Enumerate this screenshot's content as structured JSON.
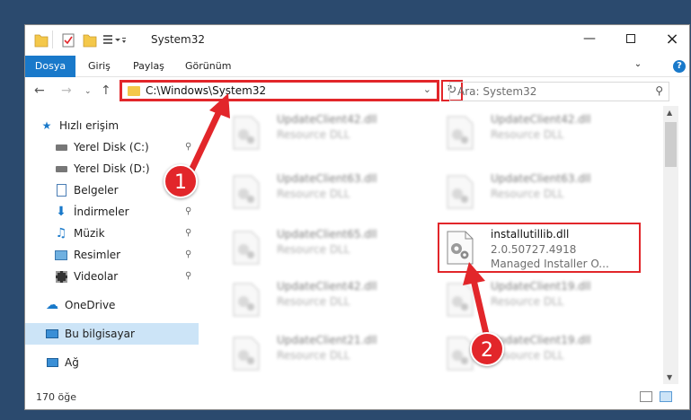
{
  "window": {
    "title": "System32"
  },
  "ribbon": {
    "tabs": [
      "Dosya",
      "Giriş",
      "Paylaş",
      "Görünüm"
    ],
    "help_label": "?"
  },
  "nav": {
    "address": "C:\\Windows\\System32",
    "search_placeholder": "Ara: System32"
  },
  "sidebar": {
    "items": [
      {
        "label": "Hızlı erişim",
        "icon": "star-icon"
      },
      {
        "label": "Yerel Disk (C:)",
        "icon": "drive-icon"
      },
      {
        "label": "Yerel Disk (D:)",
        "icon": "drive-icon"
      },
      {
        "label": "Belgeler",
        "icon": "documents-icon"
      },
      {
        "label": "İndirmeler",
        "icon": "download-icon"
      },
      {
        "label": "Müzik",
        "icon": "music-icon"
      },
      {
        "label": "Resimler",
        "icon": "pictures-icon"
      },
      {
        "label": "Videolar",
        "icon": "video-icon"
      },
      {
        "label": "OneDrive",
        "icon": "cloud-icon"
      },
      {
        "label": "Bu bilgisayar",
        "icon": "computer-icon"
      },
      {
        "label": "Ağ",
        "icon": "network-icon"
      }
    ]
  },
  "files": {
    "left": [
      {
        "name": "UpdateClient42.dll",
        "type": "Resource DLL"
      },
      {
        "name": "UpdateClient63.dll",
        "type": "Resource DLL"
      },
      {
        "name": "UpdateClient65.dll",
        "type": "Resource DLL"
      },
      {
        "name": "UpdateClient42.dll",
        "type": "Resource DLL"
      },
      {
        "name": "UpdateClient21.dll",
        "type": "Resource DLL"
      }
    ],
    "right": [
      {
        "name": "UpdateClient42.dll",
        "type": "Resource DLL"
      },
      {
        "name": "UpdateClient63.dll",
        "type": "Resource DLL"
      },
      {
        "name": "installutillib.dll",
        "version": "2.0.50727.4918",
        "type": "Managed Installer O..."
      },
      {
        "name": "UpdateClient19.dll",
        "type": "Resource DLL"
      },
      {
        "name": "UpdateClient19.dll",
        "type": "Resource DLL"
      }
    ]
  },
  "status": {
    "count": "170 öğe"
  },
  "annotations": {
    "step1": "1",
    "step2": "2",
    "color": "#e2262a"
  }
}
